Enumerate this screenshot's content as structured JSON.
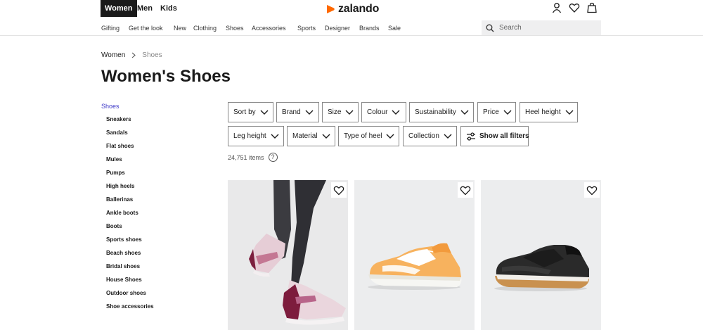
{
  "header": {
    "genders": [
      {
        "label": "Women",
        "active": true
      },
      {
        "label": "Men",
        "active": false
      },
      {
        "label": "Kids",
        "active": false
      }
    ],
    "logo_text": "zalando",
    "brand_color": "#ff6900",
    "icons": [
      "account-icon",
      "wishlist-heart-icon",
      "bag-icon"
    ]
  },
  "catnav": {
    "items": [
      "Gifting",
      "Get the look",
      "New",
      "Clothing",
      "Shoes",
      "Accessories",
      "Sports",
      "Designer",
      "Brands",
      "Sale"
    ],
    "search_placeholder": "Search"
  },
  "breadcrumb": {
    "home": "Women",
    "current": "Shoes"
  },
  "page_title": "Women's Shoes",
  "sidebar": {
    "root": "Shoes",
    "root_color": "#3d38c8",
    "items": [
      "Sneakers",
      "Sandals",
      "Flat shoes",
      "Mules",
      "Pumps",
      "High heels",
      "Ballerinas",
      "Ankle boots",
      "Boots",
      "Sports shoes",
      "Beach shoes",
      "Bridal shoes",
      "House Shoes",
      "Outdoor shoes",
      "Shoe accessories"
    ]
  },
  "filters": {
    "row1": [
      "Sort by",
      "Brand",
      "Size",
      "Colour",
      "Sustainability",
      "Price",
      "Heel height"
    ],
    "row2": [
      "Leg height",
      "Material",
      "Type of heel",
      "Collection"
    ],
    "show_all": "Show all filters"
  },
  "results": {
    "count_text": "24,751 items",
    "help_glyph": "?"
  },
  "products": [
    {
      "image": "pink-sneaker-on-model",
      "wishlist_icon": "heart-icon"
    },
    {
      "image": "orange-white-sneaker",
      "wishlist_icon": "heart-icon"
    },
    {
      "image": "black-runner-sneaker",
      "wishlist_icon": "heart-icon"
    }
  ]
}
